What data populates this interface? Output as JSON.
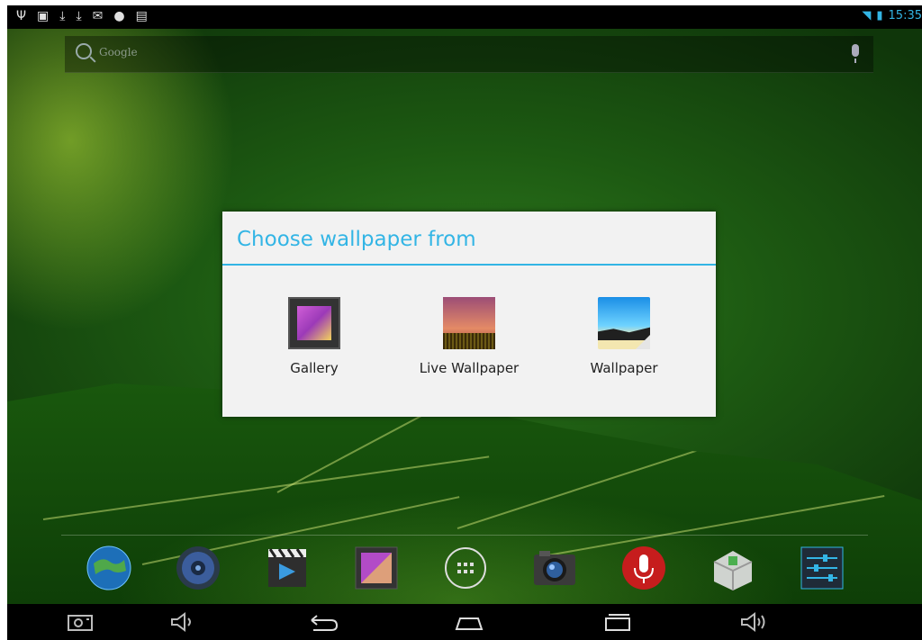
{
  "status_bar": {
    "left_icons": [
      "usb-icon",
      "image-notification-icon",
      "download-icon",
      "download-icon",
      "mail-icon",
      "game-controller-icon",
      "calendar-icon"
    ],
    "time": "15:35",
    "accent": "#33b5e5"
  },
  "search_bar": {
    "placeholder": "Google"
  },
  "dialog": {
    "title": "Choose wallpaper from",
    "options": [
      {
        "label": "Gallery",
        "icon": "gallery-icon"
      },
      {
        "label": "Live Wallpaper",
        "icon": "live-wallpaper-icon"
      },
      {
        "label": "Wallpaper",
        "icon": "wallpaper-icon"
      }
    ]
  },
  "dock": {
    "items": [
      "browser-icon",
      "music-icon",
      "video-player-icon",
      "gallery-icon",
      "all-apps-icon",
      "camera-icon",
      "voice-recorder-icon",
      "app-installer-icon",
      "settings-icon"
    ]
  },
  "nav_bar": {
    "buttons": [
      "screenshot-icon",
      "volume-down-icon",
      "back-icon",
      "home-icon",
      "recent-apps-icon",
      "volume-up-icon"
    ]
  }
}
